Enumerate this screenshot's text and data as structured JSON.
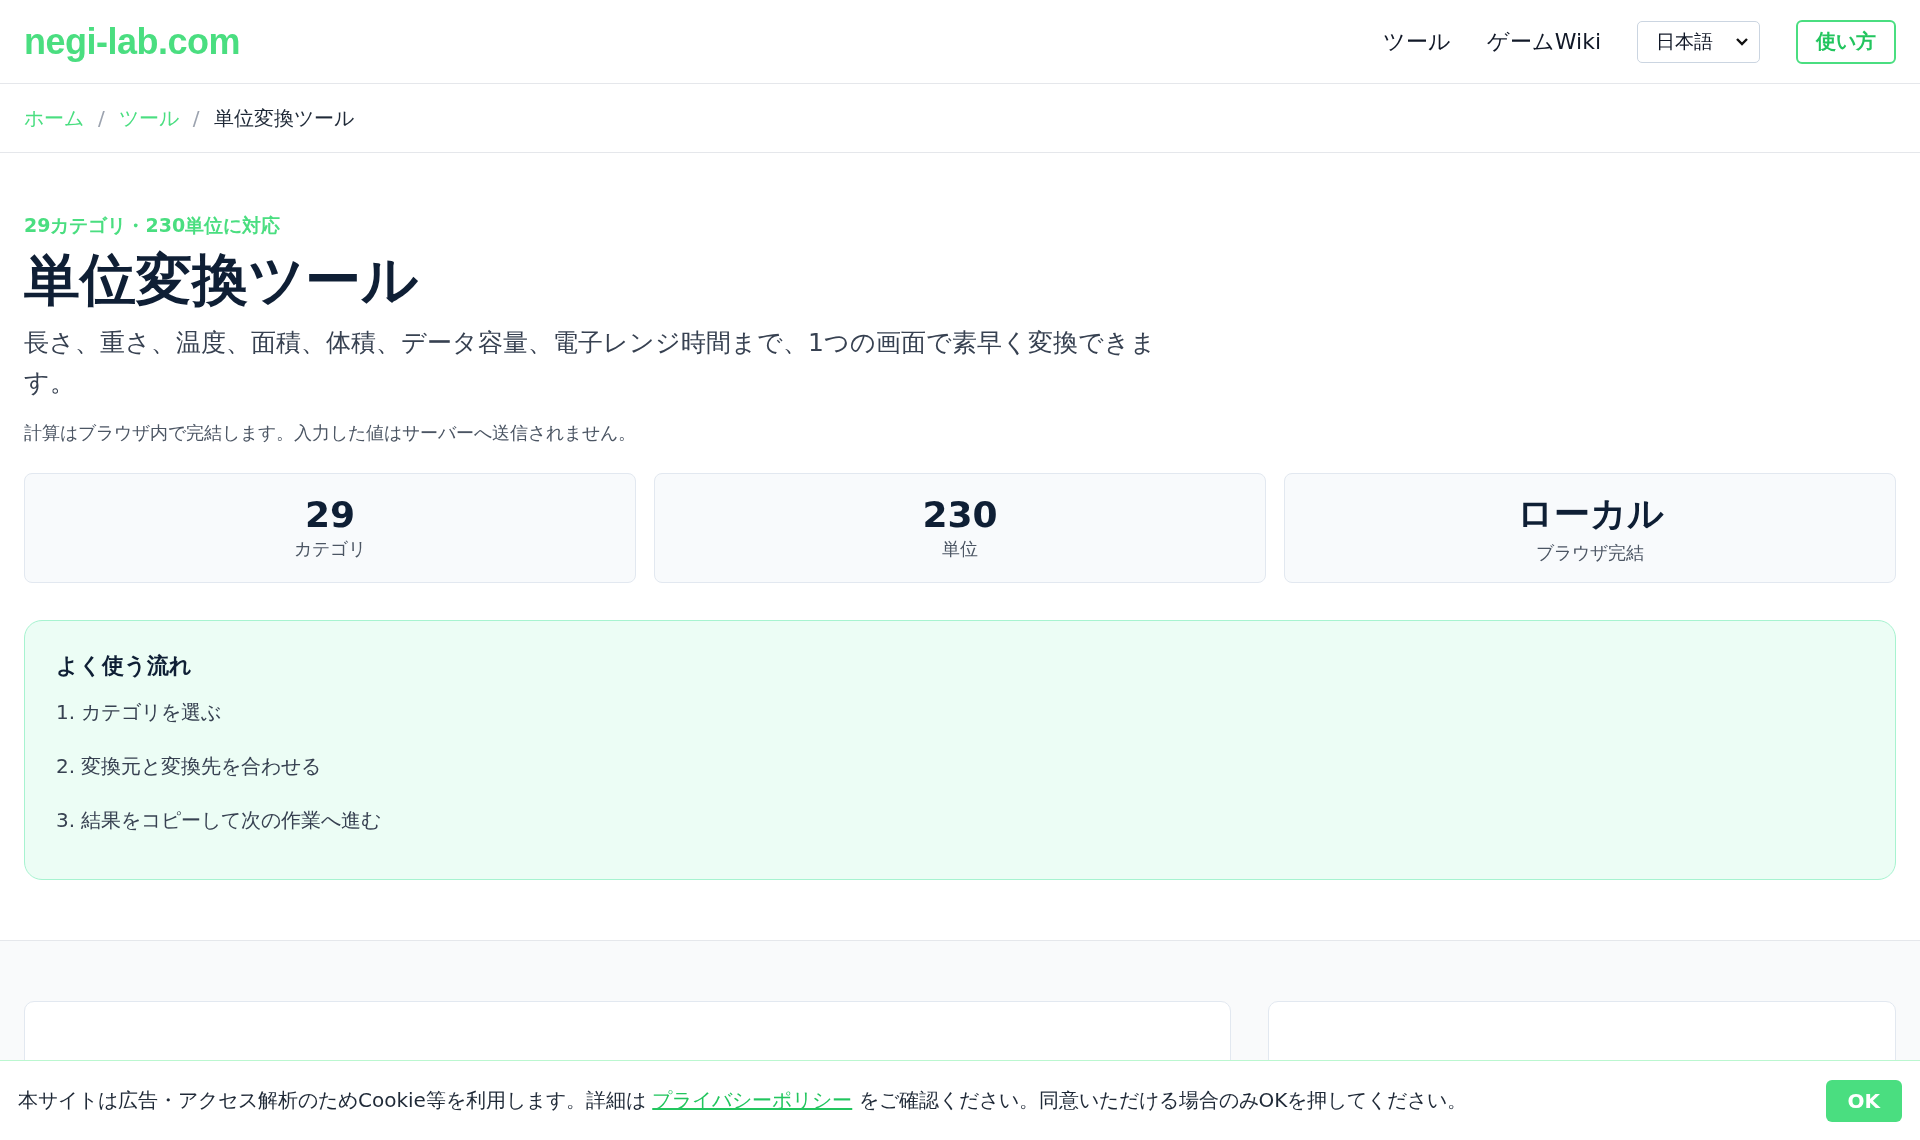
{
  "header": {
    "logo": "negi-lab.com",
    "nav": [
      {
        "label": "ツール"
      },
      {
        "label": "ゲームWiki"
      }
    ],
    "language_select": {
      "value": "日本語"
    },
    "help_button": "使い方"
  },
  "breadcrumb": [
    {
      "label": "ホーム",
      "kind": "link"
    },
    {
      "label": "/",
      "kind": "separator"
    },
    {
      "label": "ツール",
      "kind": "link"
    },
    {
      "label": "/",
      "kind": "separator"
    },
    {
      "label": "単位変換ツール",
      "kind": "current"
    }
  ],
  "hero": {
    "tagline": "29カテゴリ・230単位に対応",
    "title": "単位変換ツール",
    "description": "長さ、重さ、温度、面積、体積、データ容量、電子レンジ時間まで、1つの画面で素早く変換できます。",
    "note": "計算はブラウザ内で完結します。入力した値はサーバーへ送信されません。"
  },
  "stats": [
    {
      "value": "29",
      "label": "カテゴリ"
    },
    {
      "value": "230",
      "label": "単位"
    },
    {
      "value": "ローカル",
      "label": "ブラウザ完結"
    }
  ],
  "flow": {
    "heading": "よく使う流れ",
    "steps": [
      "1. カテゴリを選ぶ",
      "2. 変換元と変換先を合わせる",
      "3. 結果をコピーして次の作業へ進む"
    ]
  },
  "cookie_bar": {
    "text_before": "本サイトは広告・アクセス解析のためCookie等を利用します。詳細は ",
    "link": "プライバシーポリシー",
    "text_after": " をご確認ください。同意いただける場合のみOKを押してください。",
    "button": "OK"
  }
}
